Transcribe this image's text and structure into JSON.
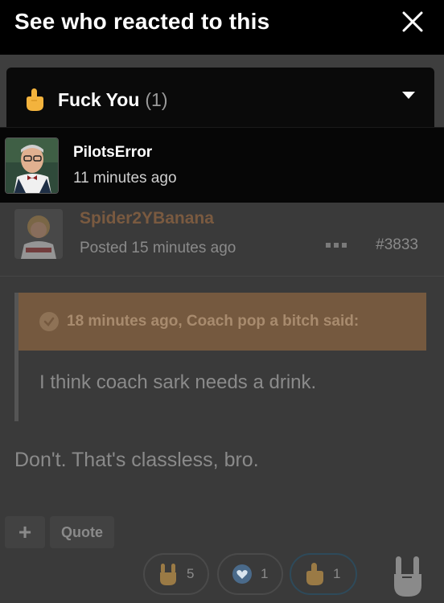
{
  "modal": {
    "title": "See who reacted to this"
  },
  "filter": {
    "reaction_label": "Fuck You",
    "count": "(1)"
  },
  "reactors": [
    {
      "name": "PilotsError",
      "time": "11 minutes ago"
    }
  ],
  "post": {
    "author": "Spider2YBanana",
    "posted": "Posted 15 minutes ago",
    "number": "#3833",
    "quote": {
      "author": "18 minutes ago, Coach pop a bitch said:",
      "text": "I think coach sark needs a drink."
    },
    "body": "Don't. That's classless, bro.",
    "actions": {
      "plus": "+",
      "quote": "Quote"
    },
    "reactions": [
      {
        "icon": "rock-on-icon",
        "count": "5"
      },
      {
        "icon": "heart-icon",
        "count": "1"
      },
      {
        "icon": "middle-finger-icon",
        "count": "1"
      }
    ]
  },
  "colors": {
    "accent_brown": "#75593f",
    "dim_text": "#8a8a8a"
  }
}
